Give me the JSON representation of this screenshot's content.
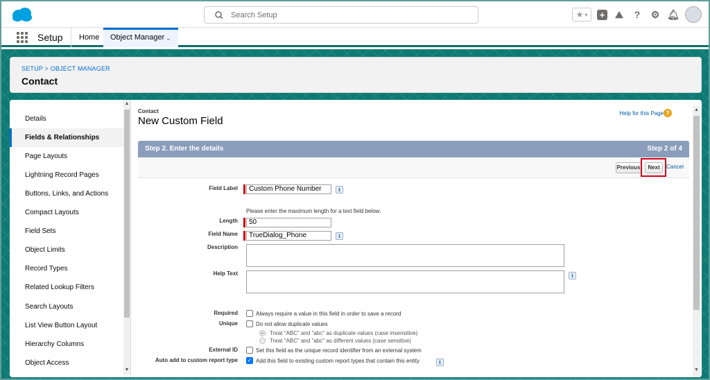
{
  "topbar": {
    "search_placeholder": "Search Setup",
    "icons": [
      "salesforce-cloud-icon",
      "search-icon",
      "star-icon",
      "add-icon",
      "trailhead-icon",
      "help-icon",
      "gear-icon",
      "bell-icon",
      "avatar"
    ]
  },
  "nav": {
    "app_name": "Setup",
    "tabs": [
      {
        "label": "Home"
      },
      {
        "label": "Object Manager"
      }
    ]
  },
  "header": {
    "breadcrumb": "SETUP > OBJECT MANAGER",
    "object": "Contact"
  },
  "sidebar": {
    "items": [
      {
        "label": "Details"
      },
      {
        "label": "Fields & Relationships"
      },
      {
        "label": "Page Layouts"
      },
      {
        "label": "Lightning Record Pages"
      },
      {
        "label": "Buttons, Links, and Actions"
      },
      {
        "label": "Compact Layouts"
      },
      {
        "label": "Field Sets"
      },
      {
        "label": "Object Limits"
      },
      {
        "label": "Record Types"
      },
      {
        "label": "Related Lookup Filters"
      },
      {
        "label": "Search Layouts"
      },
      {
        "label": "List View Button Layout"
      },
      {
        "label": "Hierarchy Columns"
      },
      {
        "label": "Object Access"
      }
    ],
    "active_index": 1
  },
  "page": {
    "context": "Contact",
    "title": "New Custom Field",
    "help_link": "Help for this Page",
    "step_title": "Step 2. Enter the details",
    "step_count": "Step 2 of 4",
    "previous_label": "Previous",
    "next_label": "Next",
    "cancel_label": "Cancel"
  },
  "form": {
    "field_label": {
      "label": "Field Label",
      "value": "Custom Phone Number"
    },
    "length_note": "Please enter the maximum length for a text field below.",
    "length": {
      "label": "Length",
      "value": "50"
    },
    "field_name": {
      "label": "Field Name",
      "value": "TrueDialog_Phone"
    },
    "description": {
      "label": "Description"
    },
    "help_text": {
      "label": "Help Text"
    },
    "required": {
      "label": "Required",
      "text": "Always require a value in this field in order to save a record"
    },
    "unique": {
      "label": "Unique",
      "text": "Do not allow duplicate values",
      "option_insensitive": "Treat \"ABC\" and \"abc\" as duplicate values (case insensitive)",
      "option_sensitive": "Treat \"ABC\" and \"abc\" as different values (case sensitive)"
    },
    "external_id": {
      "label": "External ID",
      "text": "Set this field as the unique record identifier from an external system"
    },
    "auto_add": {
      "label": "Auto add to custom report type",
      "text": "Add this field to existing custom report types that contain this entity",
      "checked": true
    }
  },
  "colors": {
    "brand_blue": "#0070d2",
    "teal_background": "#0e7a74",
    "step_bar": "#8a9ebc",
    "highlight_red": "#d0021b"
  }
}
